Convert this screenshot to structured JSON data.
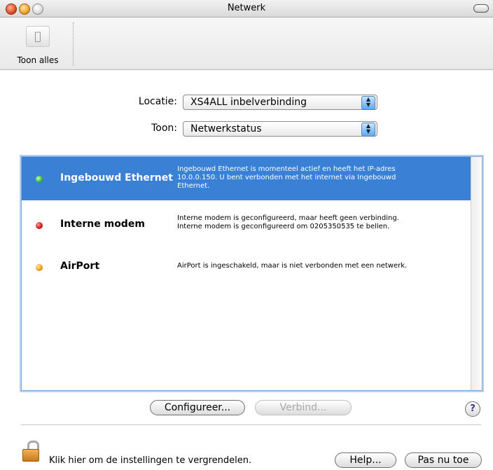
{
  "window": {
    "title": "Netwerk"
  },
  "toolbar": {
    "show_all_label": "Toon alles"
  },
  "location": {
    "label": "Locatie:",
    "value": "XS4ALL inbelverbinding"
  },
  "show": {
    "label": "Toon:",
    "value": "Netwerkstatus"
  },
  "services": [
    {
      "name": "Ingebouwd Ethernet",
      "status_color": "#3bbf3b",
      "selected": true,
      "description_lines": [
        "Ingebouwd Ethernet is momenteel actief en heeft het IP-adres",
        "10.0.0.150. U bent verbonden met het internet via Ingebouwd",
        "Ethernet."
      ]
    },
    {
      "name": "Interne modem",
      "status_color": "#cf1f1f",
      "selected": false,
      "description_lines": [
        "Interne modem is geconfigureerd, maar heeft geen verbinding.",
        "Interne modem is geconfigureerd om 0205350535 te bellen."
      ]
    },
    {
      "name": "AirPort",
      "status_color": "#f0a51e",
      "selected": false,
      "description_lines": [
        "AirPort is ingeschakeld, maar is niet verbonden met een netwerk."
      ]
    }
  ],
  "buttons": {
    "configure": "Configureer...",
    "connect": "Verbind...",
    "help_q": "?",
    "help": "Help...",
    "apply": "Pas nu toe"
  },
  "lock": {
    "text": "Klik hier om de instellingen te vergrendelen."
  },
  "colors": {
    "selection": "#3a80d4"
  }
}
